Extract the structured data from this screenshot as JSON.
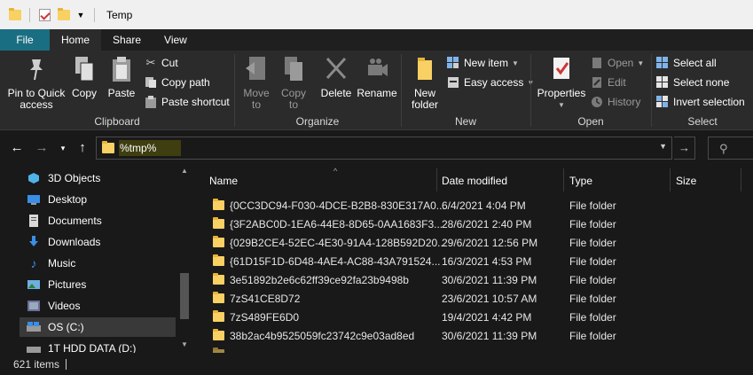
{
  "window": {
    "title": "Temp"
  },
  "tabs": [
    {
      "label": "File"
    },
    {
      "label": "Home"
    },
    {
      "label": "Share"
    },
    {
      "label": "View"
    }
  ],
  "ribbon": {
    "clipboard": {
      "label": "Clipboard",
      "pin_to_quick_access": "Pin to Quick access",
      "copy": "Copy",
      "paste": "Paste",
      "cut": "Cut",
      "copy_path": "Copy path",
      "paste_shortcut": "Paste shortcut"
    },
    "organize": {
      "label": "Organize",
      "move_to": "Move to",
      "copy_to": "Copy to",
      "delete": "Delete",
      "rename": "Rename"
    },
    "new": {
      "label": "New",
      "new_folder": "New folder",
      "new_item": "New item",
      "easy_access": "Easy access"
    },
    "open": {
      "label": "Open",
      "properties": "Properties",
      "open": "Open",
      "edit": "Edit",
      "history": "History"
    },
    "select": {
      "label": "Select",
      "select_all": "Select all",
      "select_none": "Select none",
      "invert_selection": "Invert selection"
    }
  },
  "address": {
    "value": "%tmp%"
  },
  "nav_pane": {
    "items": [
      {
        "label": "3D Objects",
        "icon": "3d-objects-icon"
      },
      {
        "label": "Desktop",
        "icon": "desktop-icon"
      },
      {
        "label": "Documents",
        "icon": "documents-icon"
      },
      {
        "label": "Downloads",
        "icon": "downloads-icon"
      },
      {
        "label": "Music",
        "icon": "music-icon"
      },
      {
        "label": "Pictures",
        "icon": "pictures-icon"
      },
      {
        "label": "Videos",
        "icon": "videos-icon"
      },
      {
        "label": "OS (C:)",
        "icon": "drive-icon"
      },
      {
        "label": "1T HDD DATA (D:)",
        "icon": "drive-icon"
      }
    ]
  },
  "columns": {
    "name": "Name",
    "date_modified": "Date modified",
    "type": "Type",
    "size": "Size"
  },
  "files": [
    {
      "name": "{0CC3DC94-F030-4DCE-B2B8-830E317A0...",
      "date": "6/4/2021 4:04 PM",
      "type": "File folder"
    },
    {
      "name": "{3F2ABC0D-1EA6-44E8-8D65-0AA1683F3...",
      "date": "28/6/2021 2:40 PM",
      "type": "File folder"
    },
    {
      "name": "{029B2CE4-52EC-4E30-91A4-128B592D20...",
      "date": "29/6/2021 12:56 PM",
      "type": "File folder"
    },
    {
      "name": "{61D15F1D-6D48-4AE4-AC88-43A791524...",
      "date": "16/3/2021 4:53 PM",
      "type": "File folder"
    },
    {
      "name": "3e51892b2e6c62ff39ce92fa23b9498b",
      "date": "30/6/2021 11:39 PM",
      "type": "File folder"
    },
    {
      "name": "7zS41CE8D72",
      "date": "23/6/2021 10:57 AM",
      "type": "File folder"
    },
    {
      "name": "7zS489FE6D0",
      "date": "19/4/2021 4:42 PM",
      "type": "File folder"
    },
    {
      "name": "38b2ac4b9525059fc23742c9e03ad8ed",
      "date": "30/6/2021 11:39 PM",
      "type": "File folder"
    }
  ],
  "status": {
    "item_count": "621 items"
  }
}
